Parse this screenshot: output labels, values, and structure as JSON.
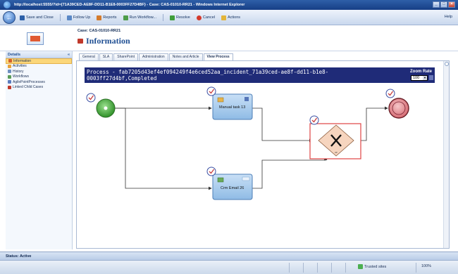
{
  "window": {
    "title": "http://localhost:5555/?id={71A39CED-AE8F-DD11-B1E8-0003FF27D4BF} - Case: CAS-01010-RR21 - Windows Internet Explorer",
    "controls": [
      "_",
      "□",
      "×"
    ]
  },
  "toolbar": {
    "items": [
      "Save and Close",
      "Follow Up",
      "Reports",
      "Run Workflow...",
      "Resolve",
      "Cancel",
      "Actions"
    ],
    "help": "Help"
  },
  "header": {
    "case_label": "Case: CAS-01010-RR21",
    "title": "Information"
  },
  "nav": {
    "header": "Details",
    "collapse": "«",
    "items": [
      {
        "label": "Information",
        "icon": "information-icon",
        "color": "#d4602e"
      },
      {
        "label": "Activities",
        "icon": "activities-icon",
        "color": "#e8a23a"
      },
      {
        "label": "History",
        "icon": "history-icon",
        "color": "#6e8fc0"
      },
      {
        "label": "Workflows",
        "icon": "workflows-icon",
        "color": "#5a9c58"
      },
      {
        "label": "AgilePointProcesses",
        "icon": "process-icon",
        "color": "#5b7dbf"
      },
      {
        "label": "Linked Child Cases",
        "icon": "cases-icon",
        "color": "#c0392b"
      }
    ]
  },
  "tabs": [
    "General",
    "SLA",
    "SharePoint",
    "Administration",
    "Notes and Article",
    "View Process"
  ],
  "process": {
    "header": "Process - fab7205d43ef4ef094249f4e6ced52aa_incident_71a39ced-ae8f-dd11-b1e8-0003ff27d4bf,Completed",
    "zoom_label": "Zoom Rate",
    "zoom_value": "100"
  },
  "diagram": {
    "task1_label": "Manual task 13",
    "task2_label": "Crm Email 26"
  },
  "status": {
    "text": "Status: Active"
  },
  "ie_status": {
    "trusted": "Trusted sites",
    "zoom": "100%"
  },
  "colors": {
    "accent": "#1f2b78",
    "start": "#52b447",
    "end": "#e38f95",
    "gateway": "#f6d5bf",
    "task": "#9ec6eb"
  }
}
